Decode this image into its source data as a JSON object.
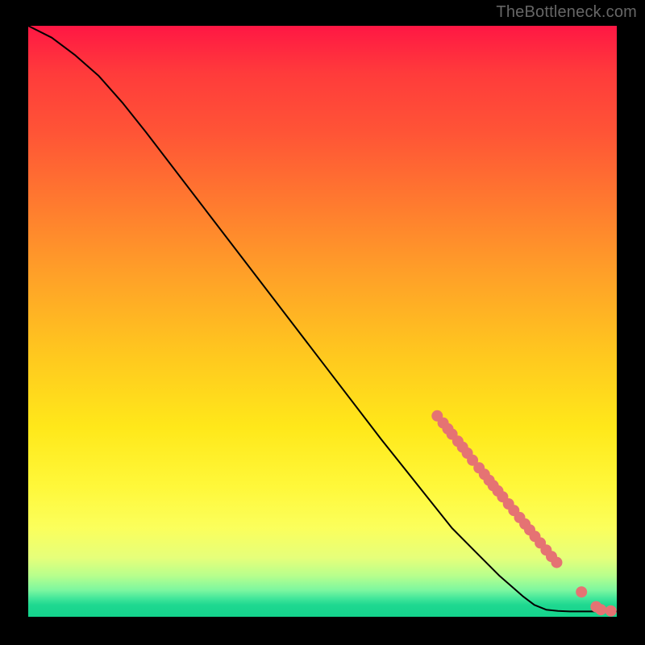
{
  "attribution": "TheBottleneck.com",
  "colors": {
    "dot": "#e57373",
    "line": "#000000",
    "gradient_top": "#ff1744",
    "gradient_mid": "#ffe81a",
    "gradient_bottom": "#13d38c"
  },
  "chart_data": {
    "type": "line",
    "title": "",
    "xlabel": "",
    "ylabel": "",
    "xlim": [
      0,
      100
    ],
    "ylim": [
      0,
      100
    ],
    "curve": [
      {
        "x": 0,
        "y": 100
      },
      {
        "x": 4,
        "y": 98
      },
      {
        "x": 8,
        "y": 95
      },
      {
        "x": 12,
        "y": 91.5
      },
      {
        "x": 16,
        "y": 87
      },
      {
        "x": 20,
        "y": 82
      },
      {
        "x": 30,
        "y": 69
      },
      {
        "x": 40,
        "y": 56
      },
      {
        "x": 50,
        "y": 43
      },
      {
        "x": 60,
        "y": 30
      },
      {
        "x": 68,
        "y": 20
      },
      {
        "x": 72,
        "y": 15
      },
      {
        "x": 76,
        "y": 11
      },
      {
        "x": 80,
        "y": 7
      },
      {
        "x": 84,
        "y": 3.5
      },
      {
        "x": 86,
        "y": 2
      },
      {
        "x": 88,
        "y": 1.2
      },
      {
        "x": 90,
        "y": 1.0
      },
      {
        "x": 92,
        "y": 0.9
      },
      {
        "x": 94,
        "y": 0.9
      },
      {
        "x": 96,
        "y": 0.9
      },
      {
        "x": 98,
        "y": 0.9
      },
      {
        "x": 100,
        "y": 0.9
      }
    ],
    "highlight_points": [
      {
        "x": 69.5,
        "y": 34.0
      },
      {
        "x": 70.5,
        "y": 32.8
      },
      {
        "x": 71.3,
        "y": 31.8
      },
      {
        "x": 72.0,
        "y": 30.9
      },
      {
        "x": 73.0,
        "y": 29.7
      },
      {
        "x": 73.8,
        "y": 28.7
      },
      {
        "x": 74.6,
        "y": 27.7
      },
      {
        "x": 75.5,
        "y": 26.5
      },
      {
        "x": 76.6,
        "y": 25.2
      },
      {
        "x": 77.5,
        "y": 24.1
      },
      {
        "x": 78.3,
        "y": 23.1
      },
      {
        "x": 79.0,
        "y": 22.2
      },
      {
        "x": 79.8,
        "y": 21.3
      },
      {
        "x": 80.6,
        "y": 20.3
      },
      {
        "x": 81.6,
        "y": 19.1
      },
      {
        "x": 82.5,
        "y": 18.0
      },
      {
        "x": 83.5,
        "y": 16.8
      },
      {
        "x": 84.4,
        "y": 15.7
      },
      {
        "x": 85.2,
        "y": 14.7
      },
      {
        "x": 86.1,
        "y": 13.6
      },
      {
        "x": 87.0,
        "y": 12.5
      },
      {
        "x": 88.0,
        "y": 11.3
      },
      {
        "x": 88.9,
        "y": 10.2
      },
      {
        "x": 89.8,
        "y": 9.2
      },
      {
        "x": 94.0,
        "y": 4.2
      },
      {
        "x": 96.5,
        "y": 1.7
      },
      {
        "x": 97.3,
        "y": 1.2
      },
      {
        "x": 99.0,
        "y": 1.0
      }
    ]
  }
}
